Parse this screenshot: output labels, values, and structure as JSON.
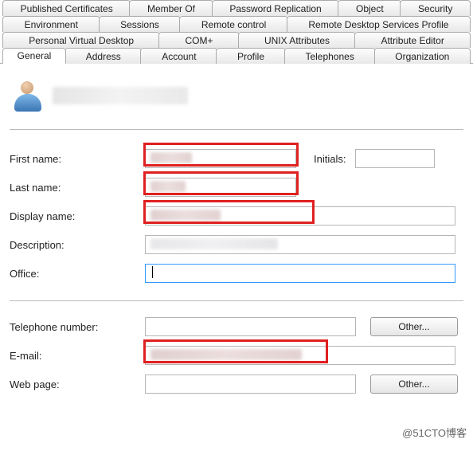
{
  "tabs": {
    "row1": [
      "Published Certificates",
      "Member Of",
      "Password Replication",
      "Object",
      "Security"
    ],
    "row2": [
      "Environment",
      "Sessions",
      "Remote control",
      "Remote Desktop Services Profile"
    ],
    "row3": [
      "Personal Virtual Desktop",
      "COM+",
      "UNIX Attributes",
      "Attribute Editor"
    ],
    "row4": [
      "General",
      "Address",
      "Account",
      "Profile",
      "Telephones",
      "Organization"
    ]
  },
  "labels": {
    "first_name": "First name:",
    "initials": "Initials:",
    "last_name": "Last name:",
    "display_name": "Display name:",
    "description": "Description:",
    "office": "Office:",
    "telephone": "Telephone number:",
    "email": "E-mail:",
    "webpage": "Web page:"
  },
  "fields": {
    "first_name": "",
    "initials": "",
    "last_name": "",
    "display_name": "",
    "description": "",
    "office": "",
    "telephone": "",
    "email": "",
    "webpage": ""
  },
  "buttons": {
    "other": "Other...",
    "other2": "Other..."
  },
  "watermark": "@51CTO博客"
}
